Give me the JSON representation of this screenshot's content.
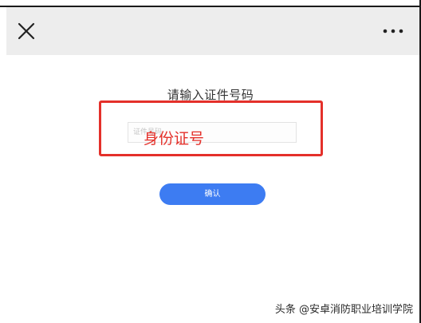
{
  "header": {
    "close_icon": "close-icon",
    "more_icon": "more-dots-icon",
    "background": "#ededed"
  },
  "form": {
    "prompt": "请输入证件号码",
    "id_input": {
      "placeholder": "证件号码",
      "value": ""
    },
    "confirm_label": "确认"
  },
  "annotation": {
    "label": "身份证号",
    "color": "#e4302a"
  },
  "watermark": {
    "text": "头条 @安卓消防职业培训学院"
  },
  "colors": {
    "accent": "#3d7cf2",
    "annotation": "#e4302a"
  }
}
